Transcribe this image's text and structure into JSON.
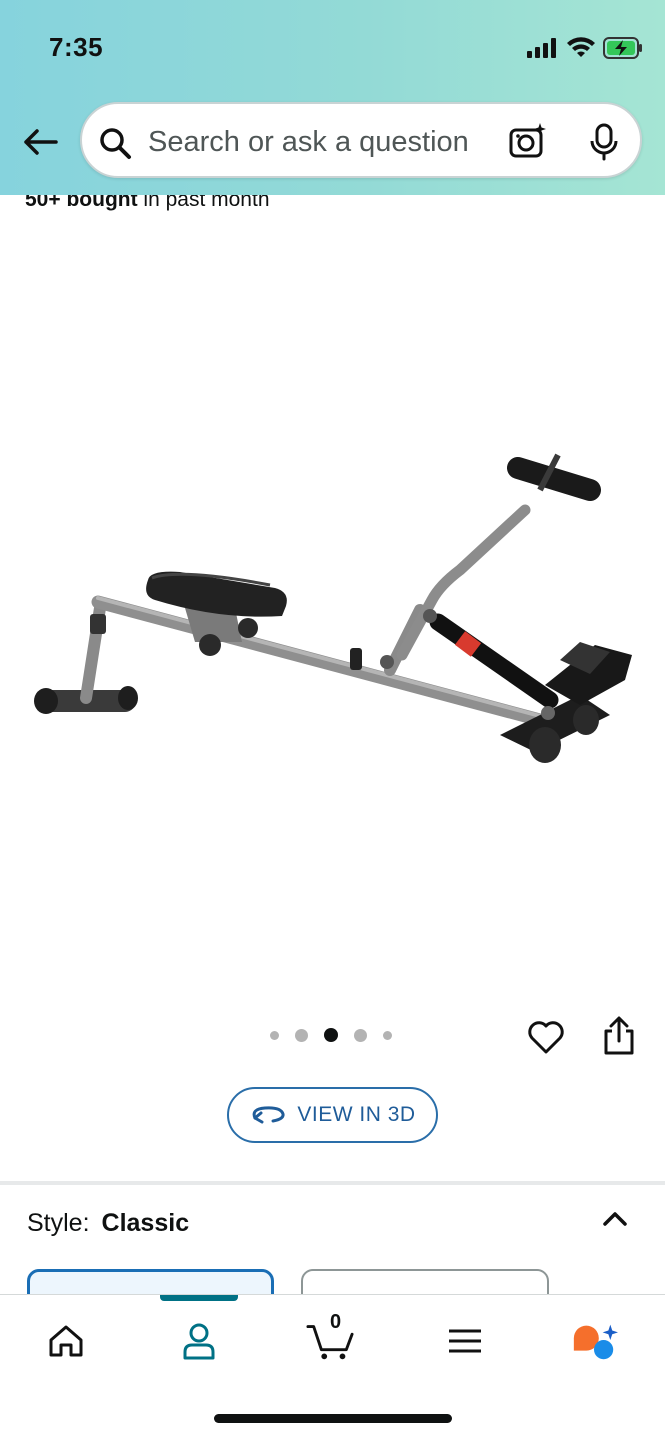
{
  "status_bar": {
    "time": "7:35",
    "icons": [
      "cellular-signal-icon",
      "wifi-icon",
      "battery-charging-icon"
    ]
  },
  "header": {
    "back_icon": "arrow-left-icon",
    "search": {
      "placeholder": "Search or ask a question",
      "icons": [
        "search-icon",
        "camera-icon",
        "microphone-icon"
      ]
    }
  },
  "product": {
    "bought_count": "50+ bought",
    "bought_suffix": " in past month",
    "image_alt": "Rowing machine",
    "gallery": {
      "total": 5,
      "active_index": 2
    },
    "actions": [
      "heart-icon",
      "share-icon"
    ],
    "view_3d_label": "VIEW IN 3D"
  },
  "style_selector": {
    "label": "Style:",
    "value": "Classic",
    "expanded_icon": "chevron-up-icon"
  },
  "bottom_nav": {
    "items": [
      {
        "name": "home",
        "icon": "home-icon"
      },
      {
        "name": "account",
        "icon": "person-icon",
        "active": true
      },
      {
        "name": "cart",
        "icon": "cart-icon",
        "count": "0"
      },
      {
        "name": "menu",
        "icon": "hamburger-menu-icon"
      },
      {
        "name": "rufus",
        "icon": "ai-assistant-icon"
      }
    ]
  },
  "colors": {
    "header_gradient_start": "#86d3dd",
    "header_gradient_end": "#a5e5d4",
    "link_blue": "#1f5c99",
    "active_tab_teal": "#007185",
    "selected_option_border": "#1a6eb5",
    "battery_green": "#34c759"
  }
}
